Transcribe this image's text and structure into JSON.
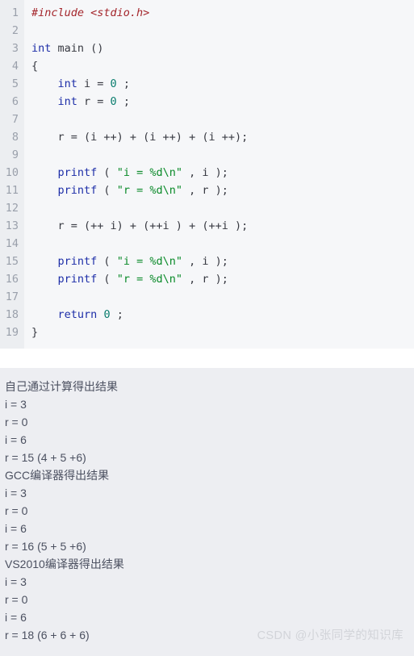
{
  "code_block": {
    "language": "c",
    "gutter_label": "line-numbers",
    "lines": [
      {
        "n": "1",
        "tokens": [
          {
            "t": "pre",
            "s": "#include <stdio.h>"
          }
        ]
      },
      {
        "n": "2",
        "tokens": []
      },
      {
        "n": "3",
        "tokens": [
          {
            "t": "k",
            "s": "int"
          },
          {
            "t": "p",
            "s": " main ()"
          }
        ]
      },
      {
        "n": "4",
        "tokens": [
          {
            "t": "p",
            "s": "{"
          }
        ]
      },
      {
        "n": "5",
        "tokens": [
          {
            "t": "p",
            "s": "    "
          },
          {
            "t": "k",
            "s": "int"
          },
          {
            "t": "p",
            "s": " i = "
          },
          {
            "t": "num",
            "s": "0"
          },
          {
            "t": "p",
            "s": " ;"
          }
        ]
      },
      {
        "n": "6",
        "tokens": [
          {
            "t": "p",
            "s": "    "
          },
          {
            "t": "k",
            "s": "int"
          },
          {
            "t": "p",
            "s": " r = "
          },
          {
            "t": "num",
            "s": "0"
          },
          {
            "t": "p",
            "s": " ;"
          }
        ]
      },
      {
        "n": "7",
        "tokens": []
      },
      {
        "n": "8",
        "tokens": [
          {
            "t": "p",
            "s": "    r = (i ++) + (i ++) + (i ++);"
          }
        ]
      },
      {
        "n": "9",
        "tokens": []
      },
      {
        "n": "10",
        "tokens": [
          {
            "t": "p",
            "s": "    "
          },
          {
            "t": "fn",
            "s": "printf"
          },
          {
            "t": "p",
            "s": " ( "
          },
          {
            "t": "str",
            "s": "\"i = %d\\n\""
          },
          {
            "t": "p",
            "s": " , i );"
          }
        ]
      },
      {
        "n": "11",
        "tokens": [
          {
            "t": "p",
            "s": "    "
          },
          {
            "t": "fn",
            "s": "printf"
          },
          {
            "t": "p",
            "s": " ( "
          },
          {
            "t": "str",
            "s": "\"r = %d\\n\""
          },
          {
            "t": "p",
            "s": " , r );"
          }
        ]
      },
      {
        "n": "12",
        "tokens": []
      },
      {
        "n": "13",
        "tokens": [
          {
            "t": "p",
            "s": "    r = (++ i) + (++i ) + (++i );"
          }
        ]
      },
      {
        "n": "14",
        "tokens": []
      },
      {
        "n": "15",
        "tokens": [
          {
            "t": "p",
            "s": "    "
          },
          {
            "t": "fn",
            "s": "printf"
          },
          {
            "t": "p",
            "s": " ( "
          },
          {
            "t": "str",
            "s": "\"i = %d\\n\""
          },
          {
            "t": "p",
            "s": " , i );"
          }
        ]
      },
      {
        "n": "16",
        "tokens": [
          {
            "t": "p",
            "s": "    "
          },
          {
            "t": "fn",
            "s": "printf"
          },
          {
            "t": "p",
            "s": " ( "
          },
          {
            "t": "str",
            "s": "\"r = %d\\n\""
          },
          {
            "t": "p",
            "s": " , r );"
          }
        ]
      },
      {
        "n": "17",
        "tokens": []
      },
      {
        "n": "18",
        "tokens": [
          {
            "t": "p",
            "s": "    "
          },
          {
            "t": "k",
            "s": "return"
          },
          {
            "t": "p",
            "s": " "
          },
          {
            "t": "num",
            "s": "0"
          },
          {
            "t": "p",
            "s": " ;"
          }
        ]
      },
      {
        "n": "19",
        "tokens": [
          {
            "t": "p",
            "s": "}"
          }
        ]
      }
    ]
  },
  "output_panel": {
    "lines": [
      {
        "text": "自己通过计算得出结果",
        "heading": true
      },
      {
        "text": "i = 3",
        "heading": false
      },
      {
        "text": "r = 0",
        "heading": false
      },
      {
        "text": "i = 6",
        "heading": false
      },
      {
        "text": "r = 15 (4 + 5 +6)",
        "heading": false
      },
      {
        "text": "GCC编译器得出结果",
        "heading": true
      },
      {
        "text": "i = 3",
        "heading": false
      },
      {
        "text": "r = 0",
        "heading": false
      },
      {
        "text": "i = 6",
        "heading": false
      },
      {
        "text": "r = 16 (5 + 5 +6)",
        "heading": true
      },
      {
        "text": "VS2010编译器得出结果",
        "heading": true
      },
      {
        "text": "i = 3",
        "heading": false
      },
      {
        "text": "r = 0",
        "heading": false
      },
      {
        "text": "i = 6",
        "heading": false
      },
      {
        "text": "r = 18 (6 + 6 + 6)",
        "heading": false
      }
    ]
  },
  "watermark": {
    "text": "CSDN @小张同学的知识库"
  },
  "colors": {
    "code_background": "#f6f7f9",
    "gutter_background": "#eceef1",
    "gutter_text": "#9aa0ab",
    "code_text": "#383a42",
    "keyword": "#1d2ea8",
    "string": "#0a8a29",
    "number": "#0a7d6e",
    "preprocessor": "#a4262c",
    "output_background": "#edeef2",
    "output_text": "#4b5060",
    "watermark_text": "#d2d4d9",
    "page_background": "#ffffff"
  }
}
